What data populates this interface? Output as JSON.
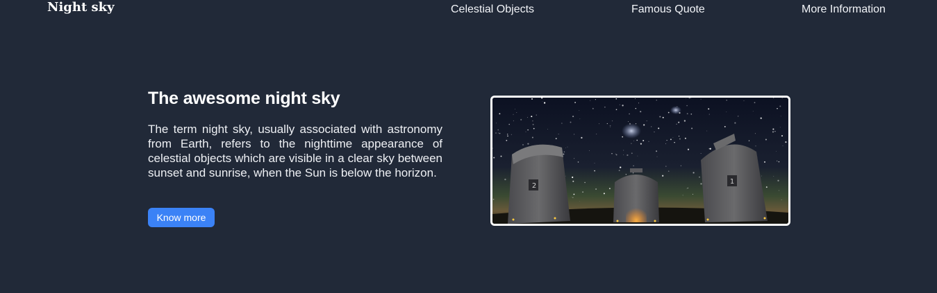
{
  "nav": {
    "brand": "Night sky",
    "links": [
      {
        "label": "Celestial Objects"
      },
      {
        "label": "Famous Quote"
      },
      {
        "label": "More Information"
      }
    ]
  },
  "hero": {
    "title": "The awesome night sky",
    "description": "The term night sky, usually associated with astronomy from Earth, refers to the nighttime appearance of celestial objects which are visible in a clear sky between sunset and sunrise, when the Sun is below the horizon.",
    "button_label": "Know more",
    "image": {
      "subject": "observatory telescopes under starry night sky",
      "telescope_labels": [
        "2",
        "1"
      ]
    }
  },
  "colors": {
    "background": "#212938",
    "accent": "#3b82f6",
    "text": "#ffffff",
    "image_border": "#ffffff"
  }
}
